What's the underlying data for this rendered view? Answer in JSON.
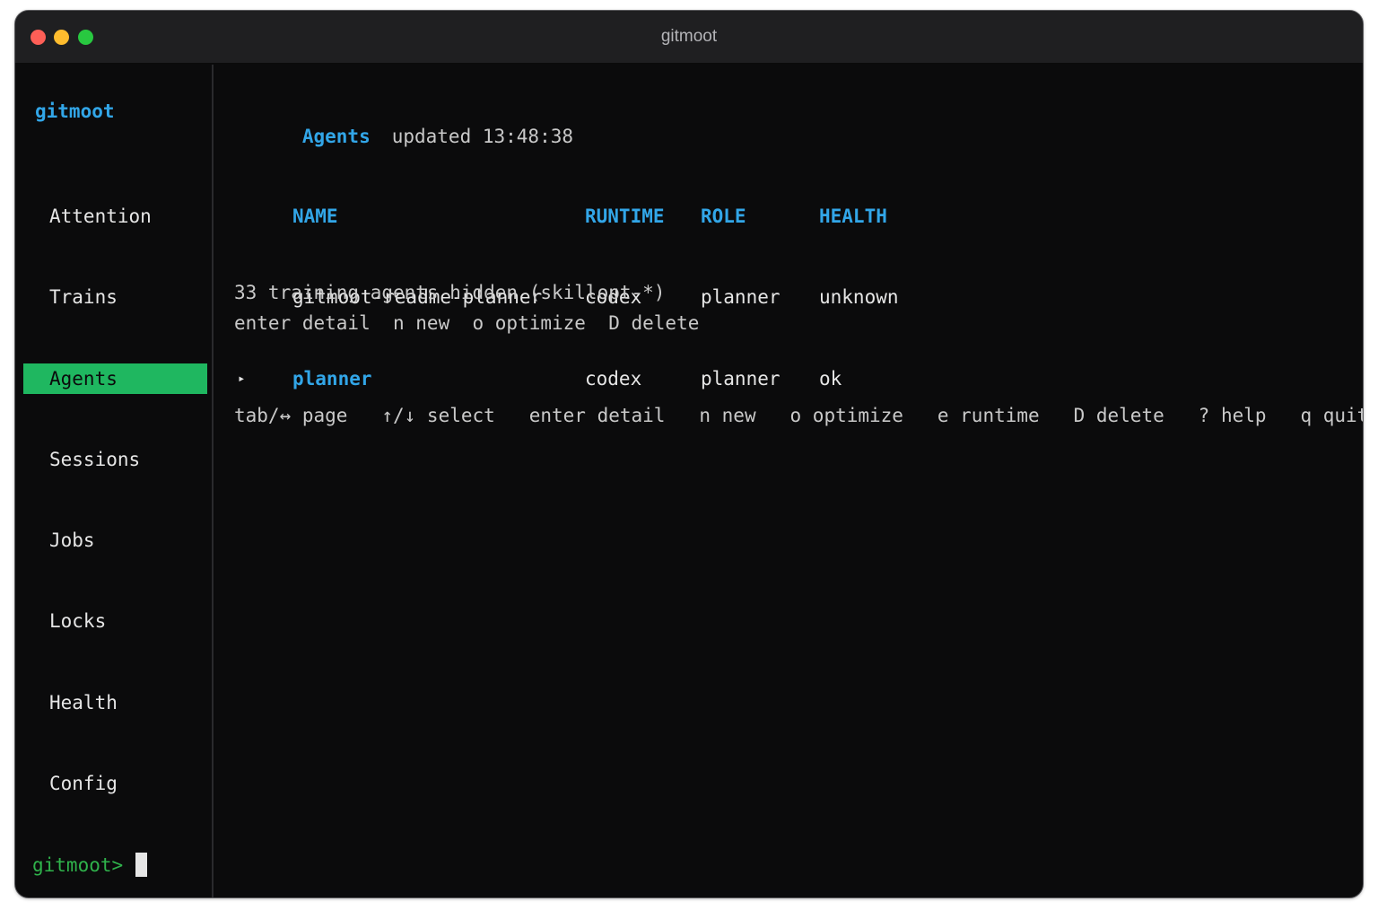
{
  "window": {
    "title": "gitmoot"
  },
  "sidebar": {
    "brand": "gitmoot",
    "items": [
      {
        "label": "Attention"
      },
      {
        "label": "Trains"
      },
      {
        "label": "Agents"
      },
      {
        "label": "Sessions"
      },
      {
        "label": "Jobs"
      },
      {
        "label": "Locks"
      },
      {
        "label": "Health"
      },
      {
        "label": "Config"
      }
    ],
    "active_index": 2,
    "prompt": "gitmoot>"
  },
  "main": {
    "title": "Agents",
    "updated": "updated 13:48:38",
    "table": {
      "columns": [
        "NAME",
        "RUNTIME",
        "ROLE",
        "HEALTH"
      ],
      "rows": [
        {
          "marker": "",
          "name": "gitmoot-readme-planner",
          "runtime": "codex",
          "role": "planner",
          "health": "unknown"
        },
        {
          "marker": "▸",
          "name": "planner",
          "runtime": "codex",
          "role": "planner",
          "health": "ok"
        }
      ],
      "selected_row": 1
    },
    "note": "33 training agents hidden (skillopt-*)",
    "hints": "enter detail  n new  o optimize  D delete",
    "footer_keys": "tab/↔ page   ↑/↓ select   enter detail   n new   o optimize   e runtime   D delete   ? help   q quit"
  },
  "colors": {
    "accent": "#32a6e8",
    "active_nav_bg": "#1fb760",
    "prompt": "#2fb24b",
    "background": "#0b0b0c"
  }
}
